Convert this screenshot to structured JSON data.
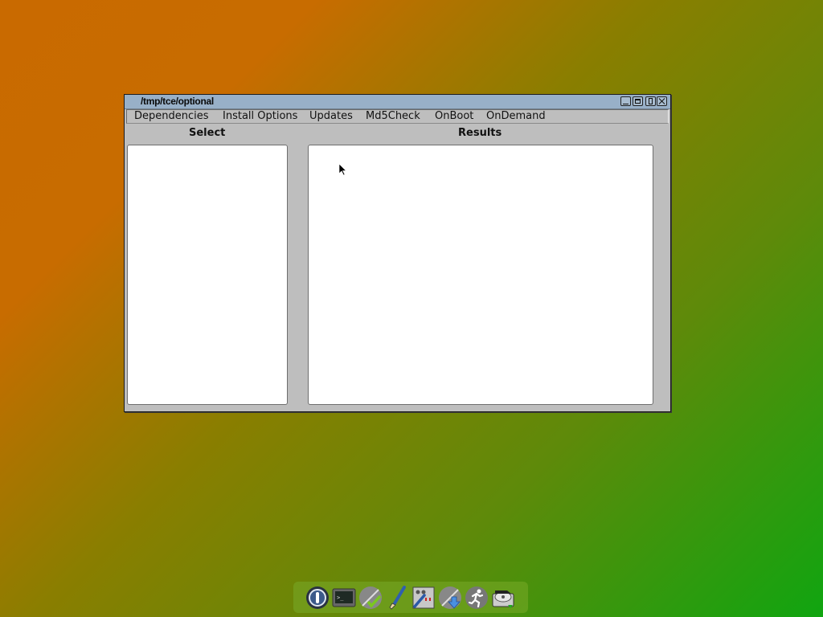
{
  "window": {
    "title": "/tmp/tce/optional",
    "controls": [
      "minimize",
      "maximize",
      "shade",
      "close"
    ]
  },
  "menubar": {
    "items": [
      {
        "label": "Dependencies"
      },
      {
        "label": "Install Options"
      },
      {
        "label": "Updates"
      },
      {
        "label": "Md5Check"
      },
      {
        "label": "OnBoot"
      },
      {
        "label": "OnDemand"
      }
    ]
  },
  "panels": {
    "select": {
      "label": "Select",
      "items": []
    },
    "results": {
      "label": "Results",
      "items": []
    }
  },
  "dock": {
    "icons": [
      "logout-icon",
      "terminal-icon",
      "apps-audit-icon",
      "paint-brush-icon",
      "control-panel-icon",
      "apps-download-icon",
      "run-icon",
      "mount-tool-icon"
    ]
  },
  "colors": {
    "titlebar": "#98b0c8",
    "window_bg": "#bebebe",
    "desktop_start": "#c96a00",
    "desktop_end": "#10a510"
  }
}
